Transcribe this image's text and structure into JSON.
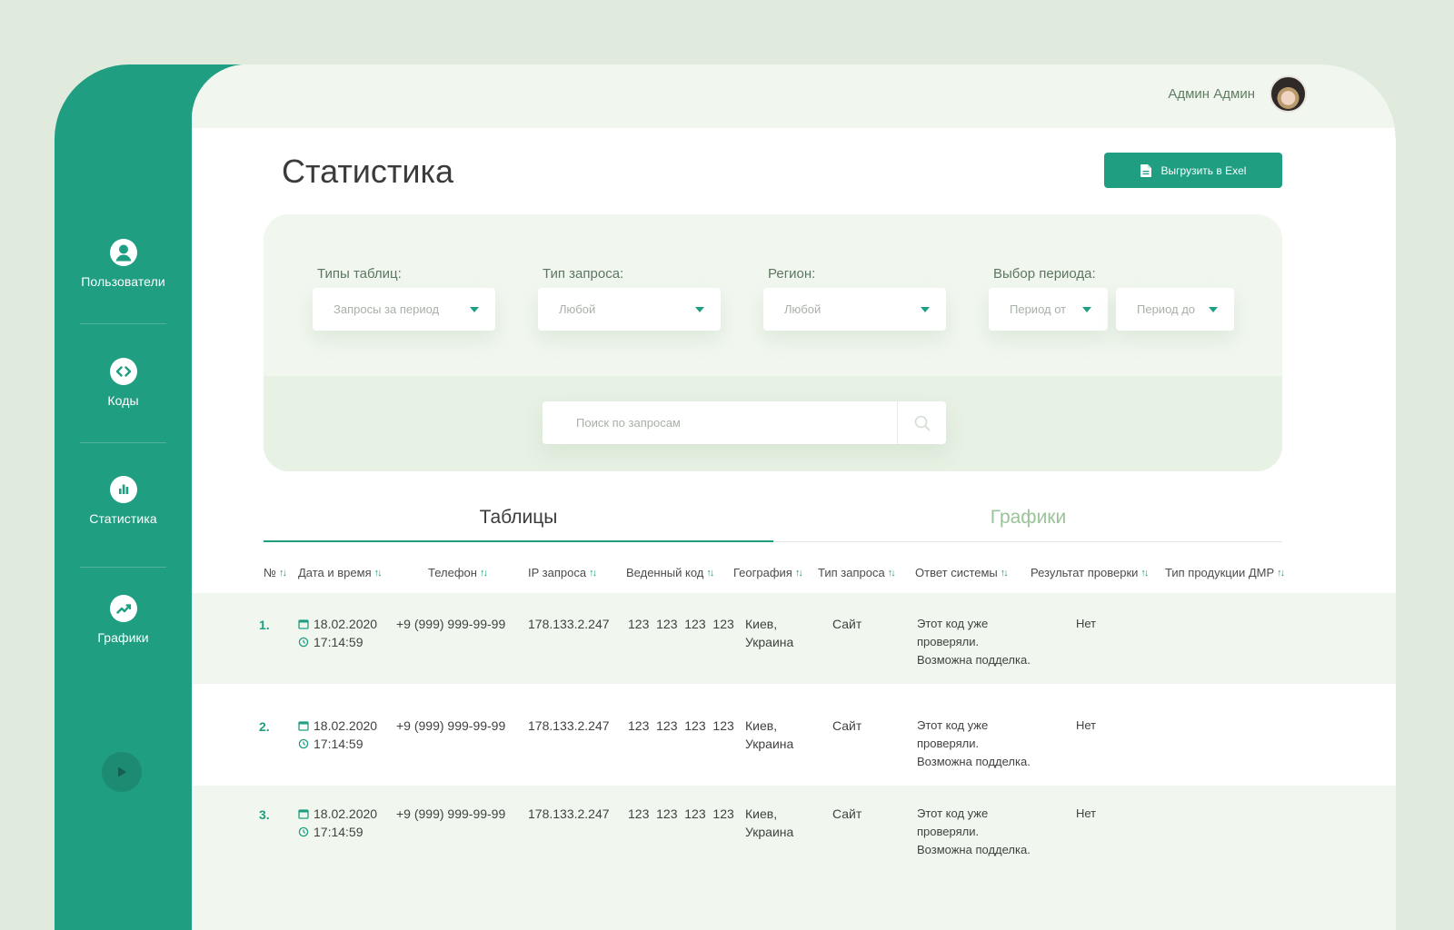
{
  "sidebar": {
    "items": [
      {
        "label": "Пользователи",
        "icon": "user-icon"
      },
      {
        "label": "Коды",
        "icon": "code-icon"
      },
      {
        "label": "Статистика",
        "icon": "bar-chart-icon"
      },
      {
        "label": "Графики",
        "icon": "trend-icon"
      }
    ]
  },
  "header": {
    "user_name": "Админ Админ"
  },
  "page": {
    "title": "Статистика",
    "export_label": "Выгрузить в Exel"
  },
  "filters": {
    "table_type": {
      "label": "Типы таблиц:",
      "value": "Запросы за период"
    },
    "request_type": {
      "label": "Тип запроса:",
      "value": "Любой"
    },
    "region": {
      "label": "Регион:",
      "value": "Любой"
    },
    "period": {
      "label": "Выбор периода:",
      "from": "Период от",
      "to": "Период до"
    }
  },
  "search": {
    "placeholder": "Поиск по запросам"
  },
  "tabs": [
    {
      "label": "Таблицы",
      "active": true
    },
    {
      "label": "Графики",
      "active": false
    }
  ],
  "table": {
    "columns": [
      "№",
      "Дата и время",
      "Телефон",
      "IP запроса",
      "Веденный код",
      "География",
      "Тип запроса",
      "Ответ системы",
      "Результат проверки",
      "Тип продукции ДМР"
    ],
    "rows": [
      {
        "num": "1.",
        "date": "18.02.2020",
        "time": "17:14:59",
        "phone": "+9 (999) 999-99-99",
        "ip": "178.133.2.247",
        "code": "123  123  123  123",
        "geo_city": "Киев,",
        "geo_country": "Украина",
        "req_type": "Сайт",
        "answer_1": "Этот код уже",
        "answer_2": "проверяли.",
        "answer_3": "Возможна подделка.",
        "result": "Нет"
      },
      {
        "num": "2.",
        "date": "18.02.2020",
        "time": "17:14:59",
        "phone": "+9 (999) 999-99-99",
        "ip": "178.133.2.247",
        "code": "123  123  123  123",
        "geo_city": "Киев,",
        "geo_country": "Украина",
        "req_type": "Сайт",
        "answer_1": "Этот код уже",
        "answer_2": "проверяли.",
        "answer_3": "Возможна подделка.",
        "result": "Нет"
      },
      {
        "num": "3.",
        "date": "18.02.2020",
        "time": "17:14:59",
        "phone": "+9 (999) 999-99-99",
        "ip": "178.133.2.247",
        "code": "123  123  123  123",
        "geo_city": "Киев,",
        "geo_country": "Украина",
        "req_type": "Сайт",
        "answer_1": "Этот код уже",
        "answer_2": "проверяли.",
        "answer_3": "Возможна подделка.",
        "result": "Нет"
      }
    ]
  },
  "colors": {
    "accent": "#1f9e82",
    "background": "#e1ebdd",
    "panel": "#f1f7ef"
  }
}
